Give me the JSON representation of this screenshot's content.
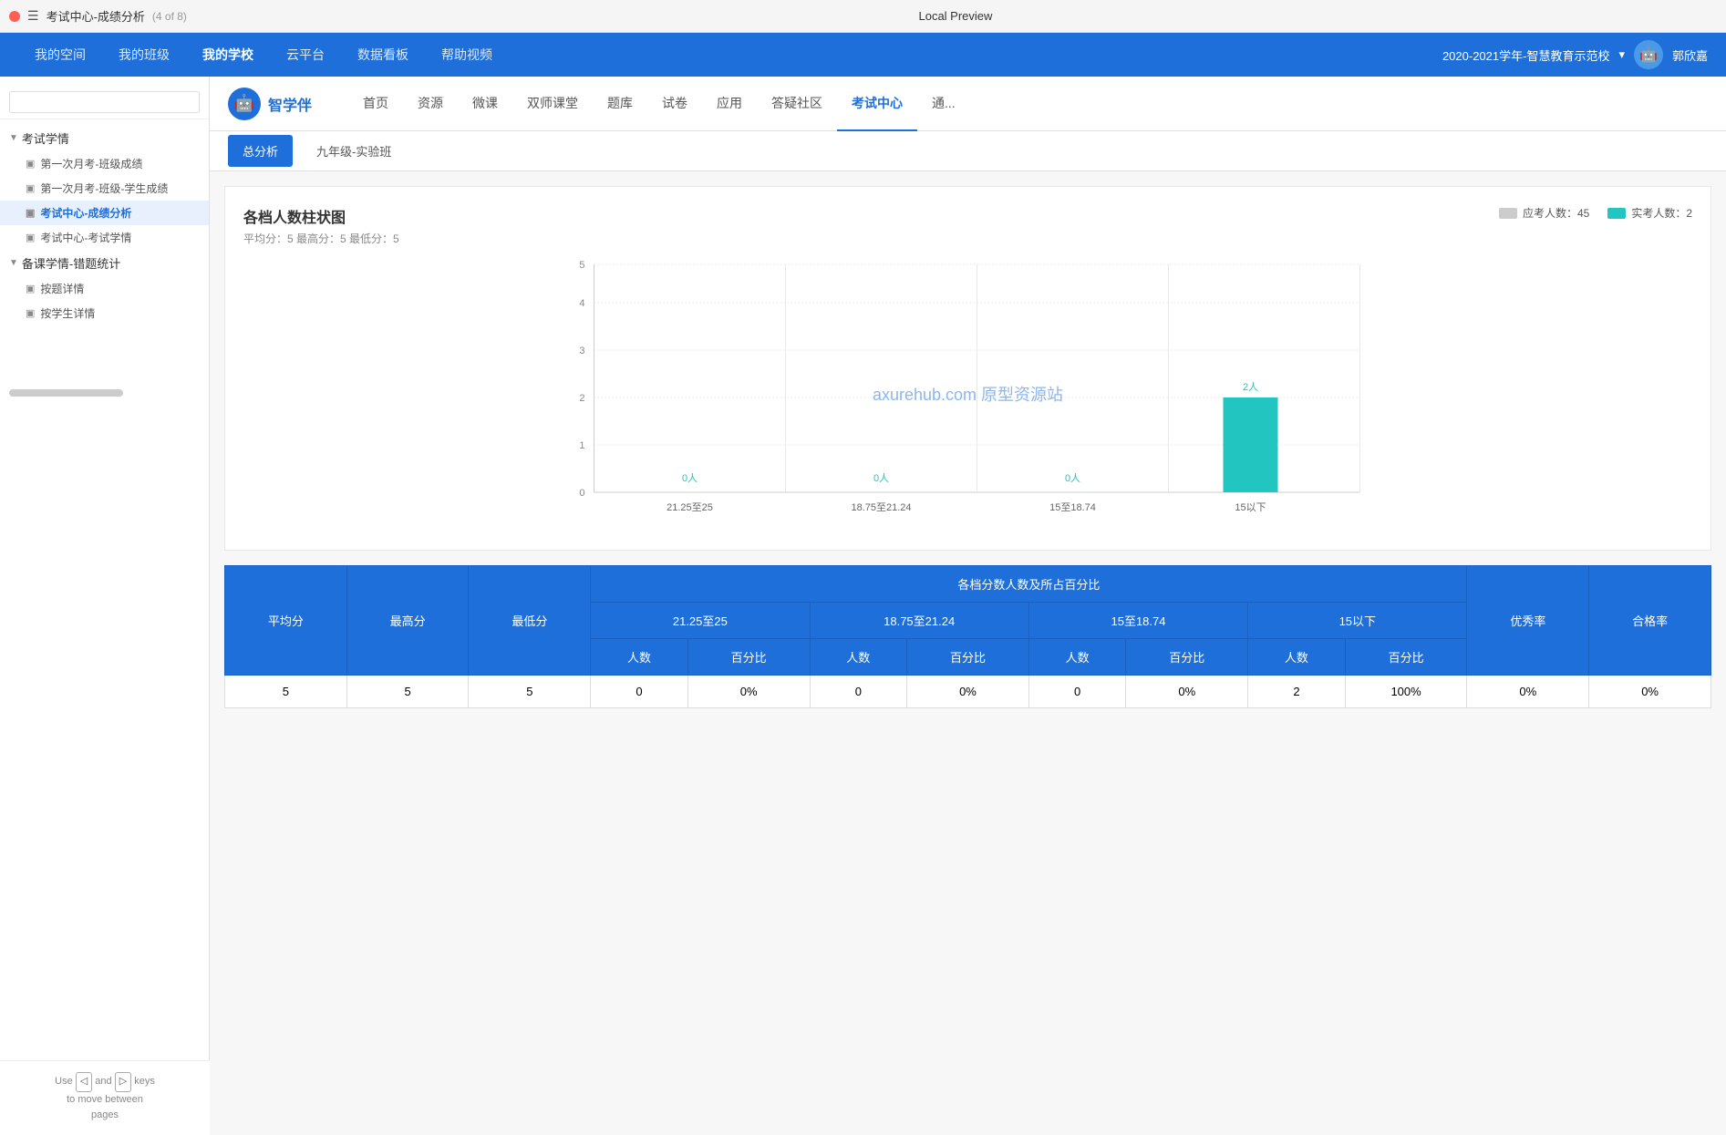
{
  "titleBar": {
    "title": "考试中心-成绩分析",
    "pageInfo": "(4 of 8)",
    "centerTitle": "Local Preview"
  },
  "topNav": {
    "items": [
      {
        "label": "我的空间",
        "active": false
      },
      {
        "label": "我的班级",
        "active": false
      },
      {
        "label": "我的学校",
        "active": true
      },
      {
        "label": "云平台",
        "active": false
      },
      {
        "label": "数据看板",
        "active": false
      },
      {
        "label": "帮助视频",
        "active": false
      }
    ],
    "year": "2020-2021学年-智慧教育示范校",
    "username": "郭欣嘉"
  },
  "sidebar": {
    "searchPlaceholder": "",
    "groups": [
      {
        "label": "考试学情",
        "expanded": true,
        "items": [
          {
            "label": "第一次月考-班级成绩",
            "active": false
          },
          {
            "label": "第一次月考-班级-学生成绩",
            "active": false
          },
          {
            "label": "考试中心-成绩分析",
            "active": true
          },
          {
            "label": "考试中心-考试学情",
            "active": false
          }
        ]
      },
      {
        "label": "备课学情-错题统计",
        "expanded": true,
        "items": [
          {
            "label": "按题详情",
            "active": false
          },
          {
            "label": "按学生详情",
            "active": false
          }
        ]
      }
    ],
    "navHint": "Use  and  keys to move between pages",
    "prevKey": "◁",
    "nextKey": "▷"
  },
  "appHeader": {
    "logoText": "智学伴",
    "navItems": [
      {
        "label": "首页",
        "active": false
      },
      {
        "label": "资源",
        "active": false
      },
      {
        "label": "微课",
        "active": false
      },
      {
        "label": "双师课堂",
        "active": false
      },
      {
        "label": "题库",
        "active": false
      },
      {
        "label": "试卷",
        "active": false
      },
      {
        "label": "应用",
        "active": false
      },
      {
        "label": "答疑社区",
        "active": false
      },
      {
        "label": "考试中心",
        "active": true
      },
      {
        "label": "通...",
        "active": false
      }
    ]
  },
  "subTabs": [
    {
      "label": "总分析",
      "active": true
    },
    {
      "label": "九年级-实验班",
      "active": false
    }
  ],
  "chart": {
    "title": "各档人数柱状图",
    "subtitle": "平均分：5  最高分：5  最低分：5",
    "legendApplicants": "应考人数：45",
    "legendActual": "实考人数：2",
    "yMax": 5,
    "yLabels": [
      "0",
      "1",
      "2",
      "3",
      "4",
      "5"
    ],
    "bars": [
      {
        "label": "21.25至25",
        "count": 0,
        "label2": "0人"
      },
      {
        "label": "18.75至21.24",
        "count": 0,
        "label2": "0人"
      },
      {
        "label": "15至18.74",
        "count": 0,
        "label2": "0人"
      },
      {
        "label": "15以下",
        "count": 2,
        "label2": "2人"
      }
    ],
    "watermark": "axurehub.com 原型资源站"
  },
  "table": {
    "headers": {
      "avgScore": "平均分",
      "maxScore": "最高分",
      "minScore": "最低分",
      "rangeGroup": "各档分数人数及所占百分比",
      "range1": "21.25至25",
      "range2": "18.75至21.24",
      "range3": "15至18.74",
      "range4": "15以下",
      "countLabel": "人数",
      "pctLabel": "百分比",
      "excellentRate": "优秀率",
      "passRate": "合格率"
    },
    "rows": [
      {
        "avg": "5",
        "max": "5",
        "min": "5",
        "r1count": "0",
        "r1pct": "0%",
        "r2count": "0",
        "r2pct": "0%",
        "r3count": "0",
        "r3pct": "0%",
        "r4count": "2",
        "r4pct": "100%",
        "excellentRate": "0%",
        "passRate": "0%"
      }
    ]
  }
}
